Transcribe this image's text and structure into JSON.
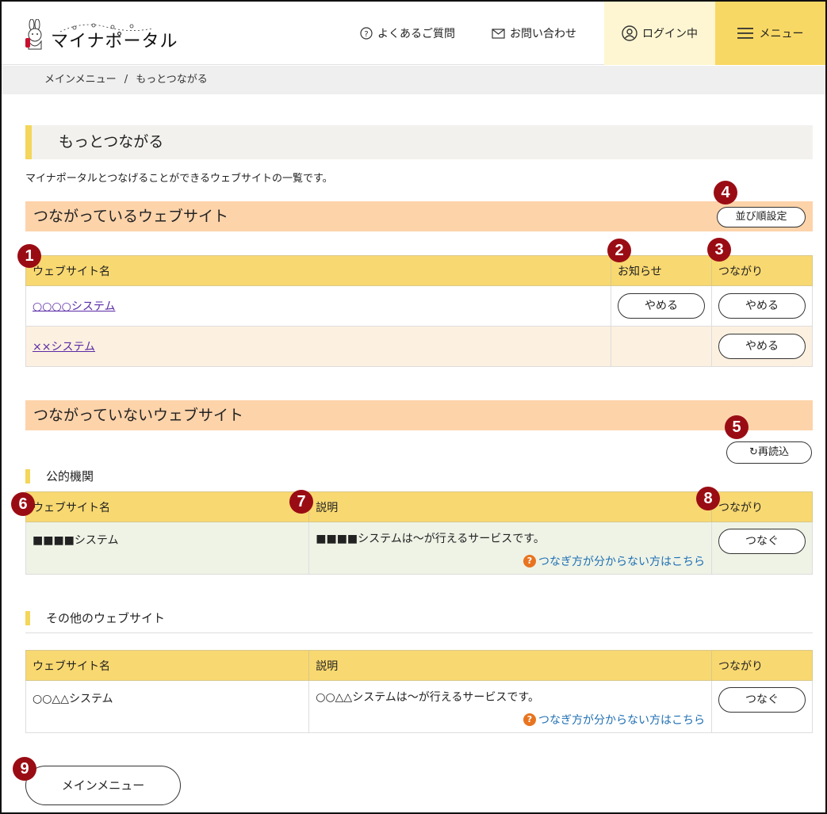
{
  "header": {
    "logo_text": "マイナポータル",
    "faq_label": "よくあるご質問",
    "contact_label": "お問い合わせ",
    "login_label": "ログイン中",
    "menu_label": "メニュー"
  },
  "breadcrumb": {
    "home": "メインメニュー",
    "separator": "/",
    "current": "もっとつながる"
  },
  "page": {
    "title": "もっとつながる",
    "intro": "マイナポータルとつなげることができるウェブサイトの一覧です。"
  },
  "connected": {
    "heading": "つながっているウェブサイト",
    "sort_button": "並び順設定",
    "columns": [
      "ウェブサイト名",
      "お知らせ",
      "つながり"
    ],
    "rows": [
      {
        "name": "○○○○システム",
        "notice_button": "やめる",
        "connection_button": "やめる"
      },
      {
        "name": "××システム",
        "notice_button": "",
        "connection_button": "やめる"
      }
    ]
  },
  "not_connected": {
    "heading": "つながっていないウェブサイト",
    "reload_button": "再読込",
    "public": {
      "heading": "公的機関",
      "columns": [
        "ウェブサイト名",
        "説明",
        "つながり"
      ],
      "rows": [
        {
          "name": "■■■■システム",
          "description": "■■■■システムは〜が行えるサービスです。",
          "help": "つなぎ方が分からない方はこちら",
          "connect_button": "つなぐ"
        }
      ]
    },
    "other": {
      "heading": "その他のウェブサイト",
      "columns": [
        "ウェブサイト名",
        "説明",
        "つながり"
      ],
      "rows": [
        {
          "name": "○○△△システム",
          "description": "○○△△システムは〜が行えるサービスです。",
          "help": "つなぎ方が分からない方はこちら",
          "connect_button": "つなぐ"
        }
      ]
    }
  },
  "footer": {
    "main_menu_button": "メインメニュー"
  },
  "callouts": [
    "1",
    "2",
    "3",
    "4",
    "5",
    "6",
    "7",
    "8",
    "9"
  ],
  "colors": {
    "accent_yellow": "#f8d864",
    "section_peach": "#fdd3aa",
    "table_header": "#f8d870",
    "callout_red": "#9a0c14",
    "link_blue": "#1f6fb3",
    "link_purple": "#5a2aa6"
  }
}
